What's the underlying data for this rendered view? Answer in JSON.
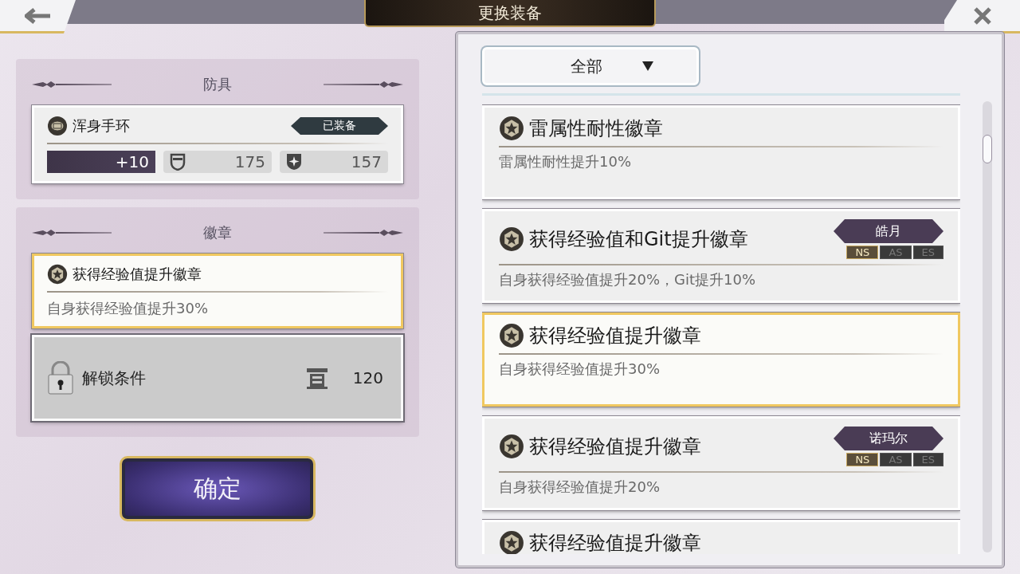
{
  "header": {
    "title": "更换装备"
  },
  "armor": {
    "heading": "防具",
    "name": "浑身手环",
    "status": "已装备",
    "enhance": "+10",
    "stats": [
      {
        "kind": "defense",
        "value": "175"
      },
      {
        "kind": "resist",
        "value": "157"
      }
    ]
  },
  "badge": {
    "heading": "徽章",
    "name": "获得经验值提升徽章",
    "effect": "自身获得经验值提升30%",
    "selected": true
  },
  "unlock": {
    "label": "解锁条件",
    "value": "120"
  },
  "confirm": {
    "label": "确定"
  },
  "filter": {
    "value": "全部"
  },
  "list": [
    {
      "name": "雷属性耐性徽章",
      "effect": "雷属性耐性提升10%",
      "selected": false
    },
    {
      "name": "获得经验值和Git提升徽章",
      "effect": "自身获得经验值提升20%，Git提升10%",
      "selected": false,
      "owner": "皓月",
      "stages": [
        {
          "label": "NS",
          "selected": true
        },
        {
          "label": "AS",
          "selected": false
        },
        {
          "label": "ES",
          "selected": false
        }
      ]
    },
    {
      "name": "获得经验值提升徽章",
      "effect": "自身获得经验值提升30%",
      "selected": true
    },
    {
      "name": "获得经验值提升徽章",
      "effect": "自身获得经验值提升20%",
      "selected": false,
      "owner": "诺玛尔",
      "stages": [
        {
          "label": "NS",
          "selected": true
        },
        {
          "label": "AS",
          "selected": false
        },
        {
          "label": "ES",
          "selected": false
        }
      ]
    },
    {
      "name": "获得经验值提升徽章",
      "selected": false
    }
  ]
}
